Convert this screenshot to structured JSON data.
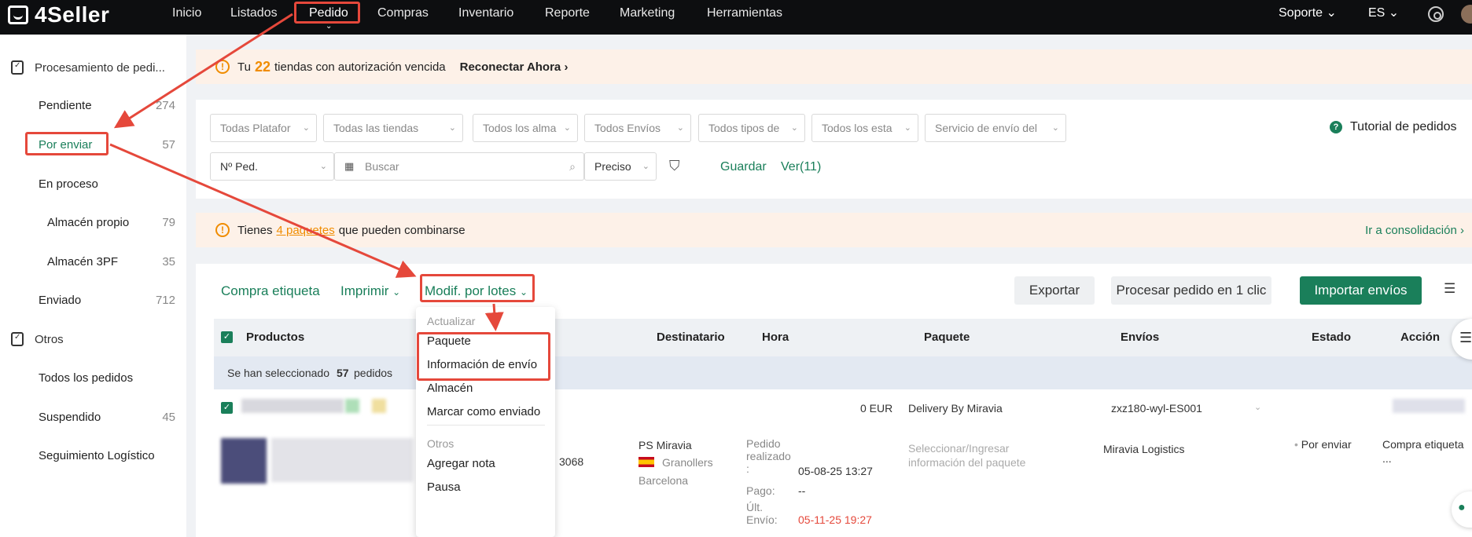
{
  "brand": {
    "name": "4Seller"
  },
  "nav": {
    "items": [
      "Inicio",
      "Listados",
      "Pedido",
      "Compras",
      "Inventario",
      "Reporte",
      "Marketing",
      "Herramientas"
    ],
    "active": "Pedido",
    "support": "Soporte",
    "language": "ES"
  },
  "sidebar": {
    "group1": "Procesamiento de pedi...",
    "items": [
      {
        "label": "Pendiente",
        "count": "274"
      },
      {
        "label": "Por enviar",
        "count": "57"
      },
      {
        "label": "En proceso",
        "count": ""
      },
      {
        "label": "Almacén propio",
        "count": "79"
      },
      {
        "label": "Almacén 3PF",
        "count": "35"
      },
      {
        "label": "Enviado",
        "count": "712"
      }
    ],
    "group2": "Otros",
    "others": [
      {
        "label": "Todos los pedidos",
        "count": ""
      },
      {
        "label": "Suspendido",
        "count": "45"
      },
      {
        "label": "Seguimiento Logístico",
        "count": ""
      }
    ]
  },
  "banner1": {
    "prefix": "Tu",
    "count": "22",
    "suffix": "tiendas con autorización vencida",
    "action": "Reconectar Ahora"
  },
  "filters": {
    "selects": [
      "Todas Platafor",
      "Todas las tiendas",
      "Todos los alma",
      "Todos Envíos",
      "Todos tipos de",
      "Todos los esta",
      "Servicio de envío del"
    ],
    "tutorial": "Tutorial de pedidos",
    "search_type": "Nº Ped.",
    "search_placeholder": "Buscar",
    "match": "Preciso",
    "save": "Guardar",
    "view": "Ver(11)"
  },
  "banner2": {
    "prefix": "Tienes",
    "link": "4 paquetes",
    "suffix": "que pueden combinarse",
    "action": "Ir a consolidación"
  },
  "toolbar": {
    "buy_label": "Compra etiqueta",
    "print": "Imprimir",
    "batch": "Modif. por lotes",
    "export": "Exportar",
    "one_click": "Procesar pedido en 1 clic",
    "import": "Importar envíos"
  },
  "table": {
    "headers": [
      "Productos",
      "Destinatario",
      "Hora",
      "Paquete",
      "Envíos",
      "Estado",
      "Acción"
    ],
    "selected_prefix": "Se han seleccionado",
    "selected_count": "57",
    "selected_suffix": "pedidos",
    "row_group": {
      "amount": "0 EUR",
      "delivery": "Delivery By Miravia",
      "warehouse": "zxz180-wyl-ES001"
    },
    "row": {
      "order_tail": "3068",
      "recipient": "PS Miravia",
      "city": "Granollers",
      "province": "Barcelona",
      "time_label1": "Pedido realizado :",
      "time_value1": "05-08-25 13:27",
      "time_label2": "Pago:",
      "time_value2": "--",
      "time_label3": "Últ. Envío:",
      "time_value3": "05-11-25 19:27",
      "package_placeholder": "Seleccionar/Ingresar información del paquete",
      "carrier": "Miravia Logistics",
      "status": "Por enviar",
      "action": "Compra etiqueta",
      "more": "..."
    }
  },
  "dropdown": {
    "section1": "Actualizar",
    "items1": [
      "Paquete",
      "Información de envío",
      "Almacén",
      "Marcar como enviado"
    ],
    "section2": "Otros",
    "items2": [
      "Agregar nota",
      "Pausa"
    ]
  },
  "colors": {
    "accent": "#1a7f5a",
    "annotation": "#e5483b",
    "warning": "#f08c00"
  }
}
